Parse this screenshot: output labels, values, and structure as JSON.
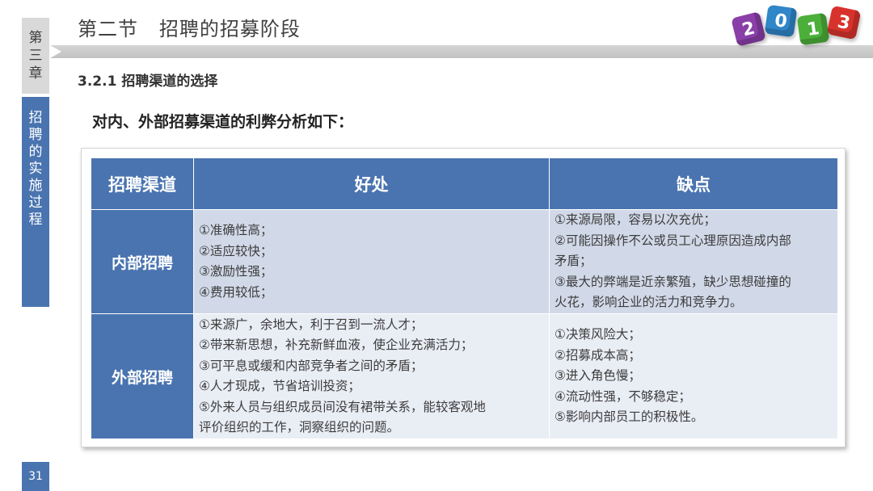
{
  "sidebar": {
    "chapter_chars": [
      "第",
      "三",
      "章"
    ],
    "section_chars": [
      "招",
      "聘",
      "的",
      "实",
      "施",
      "过",
      "程"
    ],
    "page_number": "31"
  },
  "header": {
    "title": "第二节   招聘的招募阶段"
  },
  "decoration": {
    "cubes": [
      {
        "digit": "2",
        "color": "#8a3fa8"
      },
      {
        "digit": "0",
        "color": "#2f86c8"
      },
      {
        "digit": "1",
        "color": "#4caf3a"
      },
      {
        "digit": "3",
        "color": "#d8322c"
      }
    ]
  },
  "content": {
    "section_heading": "3.2.1 招聘渠道的选择",
    "intro": "对内、外部招募渠道的利弊分析如下："
  },
  "table": {
    "headers": [
      "招聘渠道",
      "好处",
      "缺点"
    ],
    "rows": [
      {
        "channel": "内部招聘",
        "pros": [
          "①准确性高；",
          "②适应较快；",
          "③激励性强；",
          "④费用较低；"
        ],
        "cons": [
          "①来源局限，容易以次充优；",
          "②可能因操作不公或员工心理原因造成内部",
          "矛盾；",
          "③最大的弊端是近亲繁殖，缺少思想碰撞的",
          "火花，影响企业的活力和竞争力。"
        ]
      },
      {
        "channel": "外部招聘",
        "pros": [
          "①来源广，余地大，利于召到一流人才；",
          "②带来新思想，补充新鲜血液，使企业充满活力；",
          "③可平息或缓和内部竞争者之间的矛盾；",
          "④人才现成，节省培训投资；",
          "⑤外来人员与组织成员间没有裙带关系，能较客观地",
          "评价组织的工作，洞察组织的问题。"
        ],
        "cons": [
          "①决策风险大；",
          "②招募成本高；",
          "③进入角色慢；",
          "④流动性强，不够稳定；",
          "⑤影响内部员工的积极性。"
        ]
      }
    ]
  }
}
